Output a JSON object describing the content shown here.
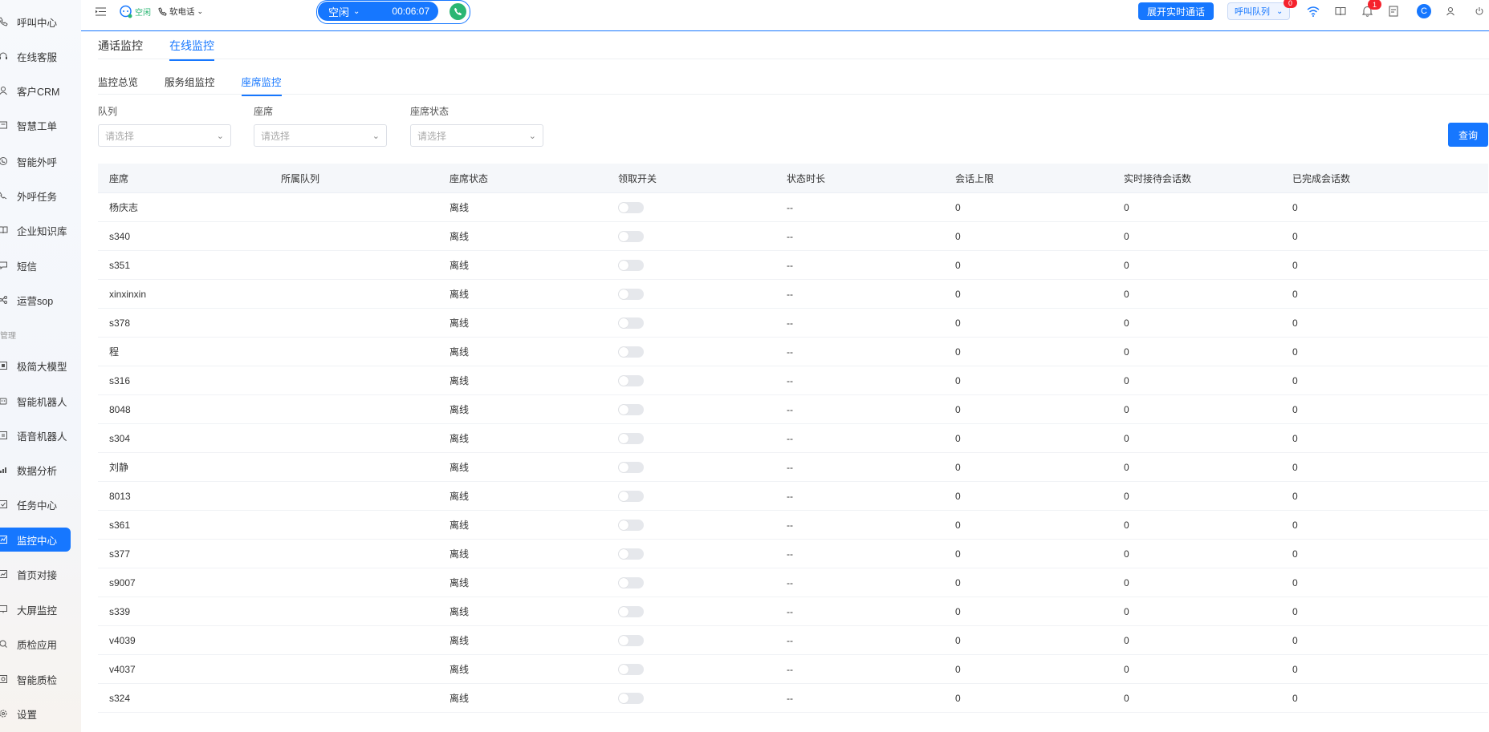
{
  "sidebar": {
    "items": [
      {
        "label": "呼叫中心",
        "icon": "phone-icon"
      },
      {
        "label": "在线客服",
        "icon": "headset-icon"
      },
      {
        "label": "客户CRM",
        "icon": "user-icon"
      },
      {
        "label": "智慧工单",
        "icon": "ticket-icon"
      },
      {
        "label": "智能外呼",
        "icon": "phone-out-icon"
      },
      {
        "label": "外呼任务",
        "icon": "task-phone-icon"
      },
      {
        "label": "企业知识库",
        "icon": "book-icon"
      },
      {
        "label": "短信",
        "icon": "message-icon"
      },
      {
        "label": "运营sop",
        "icon": "flow-icon"
      }
    ],
    "group_label": "管理",
    "items2": [
      {
        "label": "极简大模型",
        "icon": "model-icon"
      },
      {
        "label": "智能机器人",
        "icon": "robot-icon"
      },
      {
        "label": "语音机器人",
        "icon": "voice-robot-icon"
      },
      {
        "label": "数据分析",
        "icon": "chart-icon"
      },
      {
        "label": "任务中心",
        "icon": "checklist-icon"
      },
      {
        "label": "监控中心",
        "icon": "monitor-icon",
        "active": true
      },
      {
        "label": "首页对接",
        "icon": "home-link-icon"
      },
      {
        "label": "大屏监控",
        "icon": "screen-icon"
      },
      {
        "label": "质检应用",
        "icon": "inspect-icon"
      },
      {
        "label": "智能质检",
        "icon": "smart-inspect-icon"
      },
      {
        "label": "设置",
        "icon": "gear-icon"
      }
    ]
  },
  "topbar": {
    "idle_small": "空闲",
    "softphone": "软电话",
    "status": "空闲",
    "timer": "00:06:07",
    "realtime_btn": "展开实时通话",
    "queue_label": "呼叫队列",
    "queue_badge": "0",
    "bell_badge": "1",
    "avatar_letter": "C",
    "accent": "#1677ff"
  },
  "tabs": {
    "level1": [
      "通话监控",
      "在线监控"
    ],
    "level2": [
      "监控总览",
      "服务组监控",
      "座席监控"
    ]
  },
  "filters": {
    "queue_label": "队列",
    "seat_label": "座席",
    "status_label": "座席状态",
    "placeholder": "请选择",
    "query": "查询"
  },
  "table": {
    "headers": [
      "座席",
      "所属队列",
      "座席状态",
      "领取开关",
      "状态时长",
      "会话上限",
      "实时接待会话数",
      "已完成会话数"
    ],
    "rows": [
      {
        "seat": "杨庆志",
        "queue": "",
        "status": "离线",
        "duration": "--",
        "limit": "0",
        "realtime": "0",
        "done": "0"
      },
      {
        "seat": "s340",
        "queue": "",
        "status": "离线",
        "duration": "--",
        "limit": "0",
        "realtime": "0",
        "done": "0"
      },
      {
        "seat": "s351",
        "queue": "",
        "status": "离线",
        "duration": "--",
        "limit": "0",
        "realtime": "0",
        "done": "0"
      },
      {
        "seat": "xinxinxin",
        "queue": "",
        "status": "离线",
        "duration": "--",
        "limit": "0",
        "realtime": "0",
        "done": "0"
      },
      {
        "seat": "s378",
        "queue": "",
        "status": "离线",
        "duration": "--",
        "limit": "0",
        "realtime": "0",
        "done": "0"
      },
      {
        "seat": "程",
        "queue": "",
        "status": "离线",
        "duration": "--",
        "limit": "0",
        "realtime": "0",
        "done": "0"
      },
      {
        "seat": "s316",
        "queue": "",
        "status": "离线",
        "duration": "--",
        "limit": "0",
        "realtime": "0",
        "done": "0"
      },
      {
        "seat": "8048",
        "queue": "",
        "status": "离线",
        "duration": "--",
        "limit": "0",
        "realtime": "0",
        "done": "0"
      },
      {
        "seat": "s304",
        "queue": "",
        "status": "离线",
        "duration": "--",
        "limit": "0",
        "realtime": "0",
        "done": "0"
      },
      {
        "seat": "刘静",
        "queue": "",
        "status": "离线",
        "duration": "--",
        "limit": "0",
        "realtime": "0",
        "done": "0"
      },
      {
        "seat": "8013",
        "queue": "",
        "status": "离线",
        "duration": "--",
        "limit": "0",
        "realtime": "0",
        "done": "0"
      },
      {
        "seat": "s361",
        "queue": "",
        "status": "离线",
        "duration": "--",
        "limit": "0",
        "realtime": "0",
        "done": "0"
      },
      {
        "seat": "s377",
        "queue": "",
        "status": "离线",
        "duration": "--",
        "limit": "0",
        "realtime": "0",
        "done": "0"
      },
      {
        "seat": "s9007",
        "queue": "",
        "status": "离线",
        "duration": "--",
        "limit": "0",
        "realtime": "0",
        "done": "0"
      },
      {
        "seat": "s339",
        "queue": "",
        "status": "离线",
        "duration": "--",
        "limit": "0",
        "realtime": "0",
        "done": "0"
      },
      {
        "seat": "v4039",
        "queue": "",
        "status": "离线",
        "duration": "--",
        "limit": "0",
        "realtime": "0",
        "done": "0"
      },
      {
        "seat": "v4037",
        "queue": "",
        "status": "离线",
        "duration": "--",
        "limit": "0",
        "realtime": "0",
        "done": "0"
      },
      {
        "seat": "s324",
        "queue": "",
        "status": "离线",
        "duration": "--",
        "limit": "0",
        "realtime": "0",
        "done": "0"
      }
    ]
  }
}
